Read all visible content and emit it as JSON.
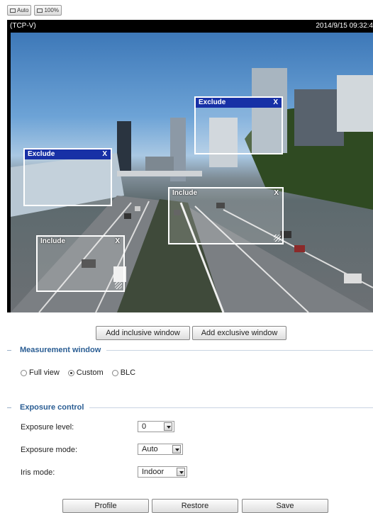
{
  "toolbar": {
    "auto_label": "Auto",
    "fit_label": "100%"
  },
  "video": {
    "source": "(TCP-V)",
    "timestamp": "2014/9/15 09:32:4"
  },
  "windows": [
    {
      "type": "Exclude",
      "close": "X"
    },
    {
      "type": "Exclude",
      "close": "X"
    },
    {
      "type": "Include",
      "close": "X"
    },
    {
      "type": "Include",
      "close": "X"
    }
  ],
  "actions": {
    "add_inclusive": "Add inclusive window",
    "add_exclusive": "Add exclusive window"
  },
  "measurement": {
    "title": "Measurement window",
    "options": [
      "Full view",
      "Custom",
      "BLC"
    ],
    "selected": "Custom"
  },
  "exposure": {
    "title": "Exposure control",
    "level_label": "Exposure level:",
    "level_value": "0",
    "mode_label": "Exposure mode:",
    "mode_value": "Auto",
    "iris_label": "Iris mode:",
    "iris_value": "Indoor"
  },
  "footer": {
    "profile": "Profile",
    "restore": "Restore",
    "save": "Save"
  }
}
